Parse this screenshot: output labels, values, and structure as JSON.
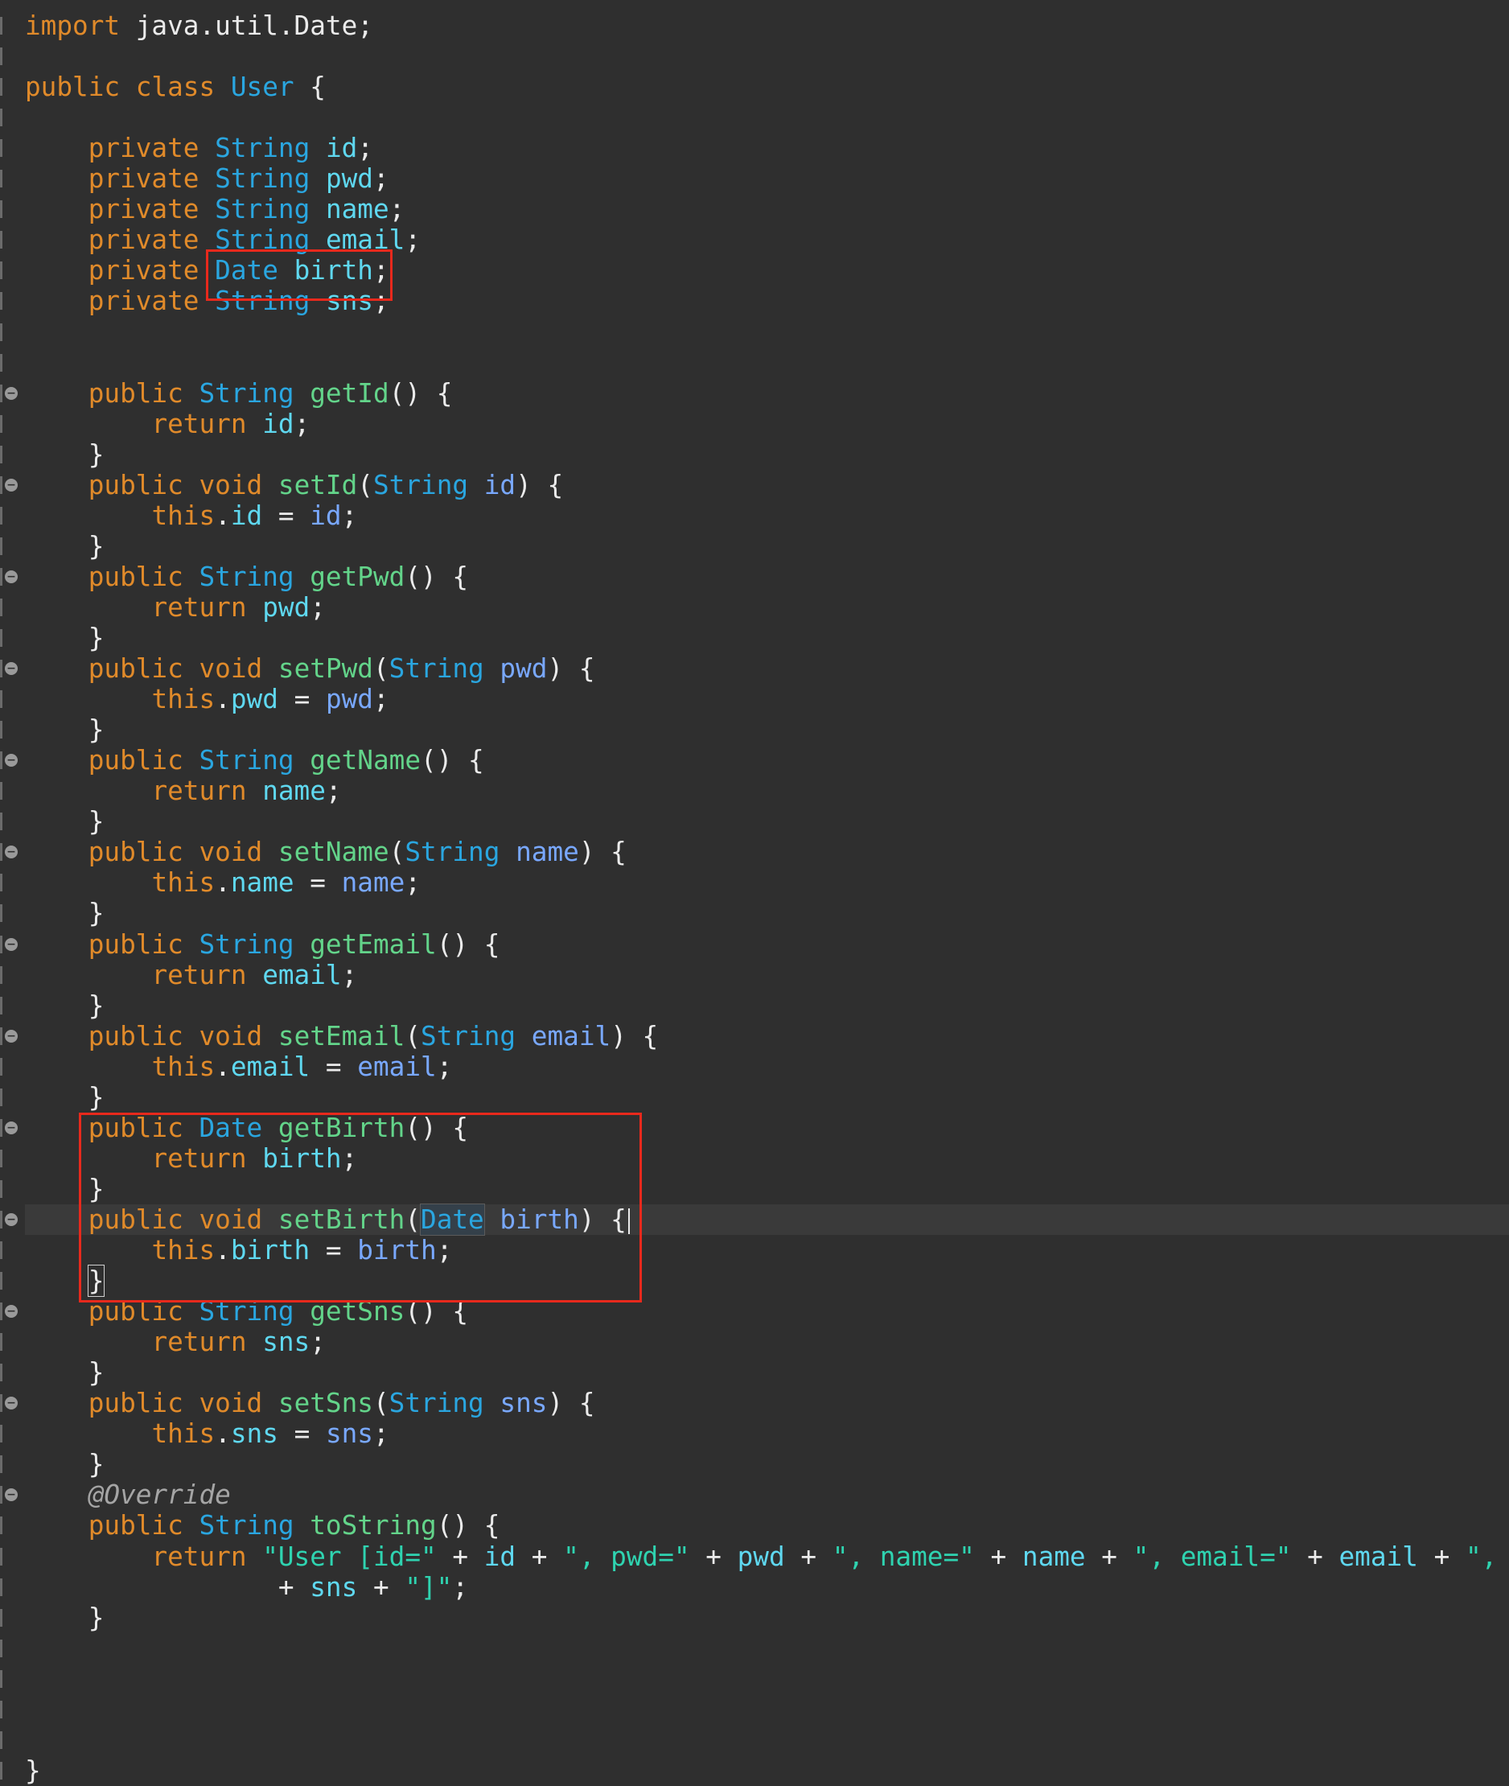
{
  "editor": {
    "language": "Java",
    "lines": [
      {
        "tokens": [
          [
            "k",
            "import"
          ],
          [
            "plain",
            " java.util.Date;"
          ]
        ]
      },
      {
        "tokens": []
      },
      {
        "tokens": [
          [
            "k",
            "public class"
          ],
          [
            "plain",
            " "
          ],
          [
            "t",
            "User"
          ],
          [
            "plain",
            " {"
          ]
        ]
      },
      {
        "tokens": []
      },
      {
        "tokens": [
          [
            "plain",
            "    "
          ],
          [
            "k",
            "private"
          ],
          [
            "plain",
            " "
          ],
          [
            "t",
            "String"
          ],
          [
            "plain",
            " "
          ],
          [
            "fld",
            "id"
          ],
          [
            "plain",
            ";"
          ]
        ]
      },
      {
        "tokens": [
          [
            "plain",
            "    "
          ],
          [
            "k",
            "private"
          ],
          [
            "plain",
            " "
          ],
          [
            "t",
            "String"
          ],
          [
            "plain",
            " "
          ],
          [
            "fld",
            "pwd"
          ],
          [
            "plain",
            ";"
          ]
        ]
      },
      {
        "tokens": [
          [
            "plain",
            "    "
          ],
          [
            "k",
            "private"
          ],
          [
            "plain",
            " "
          ],
          [
            "t",
            "String"
          ],
          [
            "plain",
            " "
          ],
          [
            "fld",
            "name"
          ],
          [
            "plain",
            ";"
          ]
        ]
      },
      {
        "tokens": [
          [
            "plain",
            "    "
          ],
          [
            "k",
            "private"
          ],
          [
            "plain",
            " "
          ],
          [
            "t",
            "String"
          ],
          [
            "plain",
            " "
          ],
          [
            "fld",
            "email"
          ],
          [
            "plain",
            ";"
          ]
        ]
      },
      {
        "tokens": [
          [
            "plain",
            "    "
          ],
          [
            "k",
            "private"
          ],
          [
            "plain",
            " "
          ],
          [
            "t",
            "Date"
          ],
          [
            "plain",
            " "
          ],
          [
            "fld",
            "birth"
          ],
          [
            "plain",
            ";"
          ]
        ]
      },
      {
        "tokens": [
          [
            "plain",
            "    "
          ],
          [
            "k",
            "private"
          ],
          [
            "plain",
            " "
          ],
          [
            "t",
            "String"
          ],
          [
            "plain",
            " "
          ],
          [
            "fld",
            "sns"
          ],
          [
            "plain",
            ";"
          ]
        ]
      },
      {
        "tokens": []
      },
      {
        "tokens": []
      },
      {
        "fold": true,
        "tokens": [
          [
            "plain",
            "    "
          ],
          [
            "k",
            "public"
          ],
          [
            "plain",
            " "
          ],
          [
            "t",
            "String"
          ],
          [
            "plain",
            " "
          ],
          [
            "f",
            "getId"
          ],
          [
            "plain",
            "() {"
          ]
        ]
      },
      {
        "tokens": [
          [
            "plain",
            "        "
          ],
          [
            "k",
            "return"
          ],
          [
            "plain",
            " "
          ],
          [
            "fld",
            "id"
          ],
          [
            "plain",
            ";"
          ]
        ]
      },
      {
        "tokens": [
          [
            "plain",
            "    }"
          ]
        ]
      },
      {
        "fold": true,
        "tokens": [
          [
            "plain",
            "    "
          ],
          [
            "k",
            "public void"
          ],
          [
            "plain",
            " "
          ],
          [
            "f",
            "setId"
          ],
          [
            "plain",
            "("
          ],
          [
            "t",
            "String"
          ],
          [
            "plain",
            " "
          ],
          [
            "p",
            "id"
          ],
          [
            "plain",
            ") {"
          ]
        ]
      },
      {
        "tokens": [
          [
            "plain",
            "        "
          ],
          [
            "k",
            "this"
          ],
          [
            "plain",
            "."
          ],
          [
            "fld",
            "id"
          ],
          [
            "plain",
            " = "
          ],
          [
            "p",
            "id"
          ],
          [
            "plain",
            ";"
          ]
        ]
      },
      {
        "tokens": [
          [
            "plain",
            "    }"
          ]
        ]
      },
      {
        "fold": true,
        "tokens": [
          [
            "plain",
            "    "
          ],
          [
            "k",
            "public"
          ],
          [
            "plain",
            " "
          ],
          [
            "t",
            "String"
          ],
          [
            "plain",
            " "
          ],
          [
            "f",
            "getPwd"
          ],
          [
            "plain",
            "() {"
          ]
        ]
      },
      {
        "tokens": [
          [
            "plain",
            "        "
          ],
          [
            "k",
            "return"
          ],
          [
            "plain",
            " "
          ],
          [
            "fld",
            "pwd"
          ],
          [
            "plain",
            ";"
          ]
        ]
      },
      {
        "tokens": [
          [
            "plain",
            "    }"
          ]
        ]
      },
      {
        "fold": true,
        "tokens": [
          [
            "plain",
            "    "
          ],
          [
            "k",
            "public void"
          ],
          [
            "plain",
            " "
          ],
          [
            "f",
            "setPwd"
          ],
          [
            "plain",
            "("
          ],
          [
            "t",
            "String"
          ],
          [
            "plain",
            " "
          ],
          [
            "p",
            "pwd"
          ],
          [
            "plain",
            ") {"
          ]
        ]
      },
      {
        "tokens": [
          [
            "plain",
            "        "
          ],
          [
            "k",
            "this"
          ],
          [
            "plain",
            "."
          ],
          [
            "fld",
            "pwd"
          ],
          [
            "plain",
            " = "
          ],
          [
            "p",
            "pwd"
          ],
          [
            "plain",
            ";"
          ]
        ]
      },
      {
        "tokens": [
          [
            "plain",
            "    }"
          ]
        ]
      },
      {
        "fold": true,
        "tokens": [
          [
            "plain",
            "    "
          ],
          [
            "k",
            "public"
          ],
          [
            "plain",
            " "
          ],
          [
            "t",
            "String"
          ],
          [
            "plain",
            " "
          ],
          [
            "f",
            "getName"
          ],
          [
            "plain",
            "() {"
          ]
        ]
      },
      {
        "tokens": [
          [
            "plain",
            "        "
          ],
          [
            "k",
            "return"
          ],
          [
            "plain",
            " "
          ],
          [
            "fld",
            "name"
          ],
          [
            "plain",
            ";"
          ]
        ]
      },
      {
        "tokens": [
          [
            "plain",
            "    }"
          ]
        ]
      },
      {
        "fold": true,
        "tokens": [
          [
            "plain",
            "    "
          ],
          [
            "k",
            "public void"
          ],
          [
            "plain",
            " "
          ],
          [
            "f",
            "setName"
          ],
          [
            "plain",
            "("
          ],
          [
            "t",
            "String"
          ],
          [
            "plain",
            " "
          ],
          [
            "p",
            "name"
          ],
          [
            "plain",
            ") {"
          ]
        ]
      },
      {
        "tokens": [
          [
            "plain",
            "        "
          ],
          [
            "k",
            "this"
          ],
          [
            "plain",
            "."
          ],
          [
            "fld",
            "name"
          ],
          [
            "plain",
            " = "
          ],
          [
            "p",
            "name"
          ],
          [
            "plain",
            ";"
          ]
        ]
      },
      {
        "tokens": [
          [
            "plain",
            "    }"
          ]
        ]
      },
      {
        "fold": true,
        "tokens": [
          [
            "plain",
            "    "
          ],
          [
            "k",
            "public"
          ],
          [
            "plain",
            " "
          ],
          [
            "t",
            "String"
          ],
          [
            "plain",
            " "
          ],
          [
            "f",
            "getEmail"
          ],
          [
            "plain",
            "() {"
          ]
        ]
      },
      {
        "tokens": [
          [
            "plain",
            "        "
          ],
          [
            "k",
            "return"
          ],
          [
            "plain",
            " "
          ],
          [
            "fld",
            "email"
          ],
          [
            "plain",
            ";"
          ]
        ]
      },
      {
        "tokens": [
          [
            "plain",
            "    }"
          ]
        ]
      },
      {
        "fold": true,
        "tokens": [
          [
            "plain",
            "    "
          ],
          [
            "k",
            "public void"
          ],
          [
            "plain",
            " "
          ],
          [
            "f",
            "setEmail"
          ],
          [
            "plain",
            "("
          ],
          [
            "t",
            "String"
          ],
          [
            "plain",
            " "
          ],
          [
            "p",
            "email"
          ],
          [
            "plain",
            ") {"
          ]
        ]
      },
      {
        "tokens": [
          [
            "plain",
            "        "
          ],
          [
            "k",
            "this"
          ],
          [
            "plain",
            "."
          ],
          [
            "fld",
            "email"
          ],
          [
            "plain",
            " = "
          ],
          [
            "p",
            "email"
          ],
          [
            "plain",
            ";"
          ]
        ]
      },
      {
        "tokens": [
          [
            "plain",
            "    }"
          ]
        ]
      },
      {
        "fold": true,
        "tokens": [
          [
            "plain",
            "    "
          ],
          [
            "k",
            "public"
          ],
          [
            "plain",
            " "
          ],
          [
            "t",
            "Date"
          ],
          [
            "plain",
            " "
          ],
          [
            "f",
            "getBirth"
          ],
          [
            "plain",
            "() {"
          ]
        ]
      },
      {
        "tokens": [
          [
            "plain",
            "        "
          ],
          [
            "k",
            "return"
          ],
          [
            "plain",
            " "
          ],
          [
            "fld",
            "birth"
          ],
          [
            "plain",
            ";"
          ]
        ]
      },
      {
        "tokens": [
          [
            "plain",
            "    }"
          ]
        ]
      },
      {
        "fold": true,
        "current": true,
        "tokens": [
          [
            "plain",
            "    "
          ],
          [
            "k",
            "public void"
          ],
          [
            "plain",
            " "
          ],
          [
            "f",
            "setBirth"
          ],
          [
            "plain",
            "("
          ],
          [
            "t occ",
            "Date"
          ],
          [
            "plain",
            " "
          ],
          [
            "p",
            "birth"
          ],
          [
            "plain",
            ") {"
          ]
        ]
      },
      {
        "tokens": [
          [
            "plain",
            "        "
          ],
          [
            "k",
            "this"
          ],
          [
            "plain",
            "."
          ],
          [
            "fld",
            "birth"
          ],
          [
            "plain",
            " = "
          ],
          [
            "p",
            "birth"
          ],
          [
            "plain",
            ";"
          ]
        ]
      },
      {
        "tokens": [
          [
            "plain",
            "    "
          ],
          [
            "plain bracket",
            "}"
          ]
        ]
      },
      {
        "fold": true,
        "tokens": [
          [
            "plain",
            "    "
          ],
          [
            "k",
            "public"
          ],
          [
            "plain",
            " "
          ],
          [
            "t",
            "String"
          ],
          [
            "plain",
            " "
          ],
          [
            "f",
            "getSns"
          ],
          [
            "plain",
            "() {"
          ]
        ]
      },
      {
        "tokens": [
          [
            "plain",
            "        "
          ],
          [
            "k",
            "return"
          ],
          [
            "plain",
            " "
          ],
          [
            "fld",
            "sns"
          ],
          [
            "plain",
            ";"
          ]
        ]
      },
      {
        "tokens": [
          [
            "plain",
            "    }"
          ]
        ]
      },
      {
        "fold": true,
        "tokens": [
          [
            "plain",
            "    "
          ],
          [
            "k",
            "public void"
          ],
          [
            "plain",
            " "
          ],
          [
            "f",
            "setSns"
          ],
          [
            "plain",
            "("
          ],
          [
            "t",
            "String"
          ],
          [
            "plain",
            " "
          ],
          [
            "p",
            "sns"
          ],
          [
            "plain",
            ") {"
          ]
        ]
      },
      {
        "tokens": [
          [
            "plain",
            "        "
          ],
          [
            "k",
            "this"
          ],
          [
            "plain",
            "."
          ],
          [
            "fld",
            "sns"
          ],
          [
            "plain",
            " = "
          ],
          [
            "p",
            "sns"
          ],
          [
            "plain",
            ";"
          ]
        ]
      },
      {
        "tokens": [
          [
            "plain",
            "    }"
          ]
        ]
      },
      {
        "fold": true,
        "tokens": [
          [
            "plain",
            "    "
          ],
          [
            "a",
            "@Override"
          ]
        ]
      },
      {
        "tokens": [
          [
            "plain",
            "    "
          ],
          [
            "k",
            "public"
          ],
          [
            "plain",
            " "
          ],
          [
            "t",
            "String"
          ],
          [
            "plain",
            " "
          ],
          [
            "f",
            "toString"
          ],
          [
            "plain",
            "() {"
          ]
        ]
      },
      {
        "tokens": [
          [
            "plain",
            "        "
          ],
          [
            "k",
            "return"
          ],
          [
            "plain",
            " "
          ],
          [
            "s",
            "\"User [id=\""
          ],
          [
            "plain",
            " + "
          ],
          [
            "fld",
            "id"
          ],
          [
            "plain",
            " + "
          ],
          [
            "s",
            "\", pwd=\""
          ],
          [
            "plain",
            " + "
          ],
          [
            "fld",
            "pwd"
          ],
          [
            "plain",
            " + "
          ],
          [
            "s",
            "\", name=\""
          ],
          [
            "plain",
            " + "
          ],
          [
            "fld",
            "name"
          ],
          [
            "plain",
            " + "
          ],
          [
            "s",
            "\", email=\""
          ],
          [
            "plain",
            " + "
          ],
          [
            "fld",
            "email"
          ],
          [
            "plain",
            " + "
          ],
          [
            "s",
            "\", bi"
          ]
        ]
      },
      {
        "tokens": [
          [
            "plain",
            "                + "
          ],
          [
            "fld",
            "sns"
          ],
          [
            "plain",
            " + "
          ],
          [
            "s",
            "\"]\""
          ],
          [
            "plain",
            ";"
          ]
        ]
      },
      {
        "tokens": [
          [
            "plain",
            "    }"
          ]
        ]
      },
      {
        "tokens": []
      },
      {
        "tokens": []
      },
      {
        "tokens": []
      },
      {
        "tokens": []
      },
      {
        "tokens": [
          [
            "plain",
            "}"
          ]
        ]
      }
    ]
  },
  "annotations": {
    "box_color": "#e8291c",
    "boxes": [
      "field-birth-highlight",
      "birth-accessors-highlight"
    ]
  }
}
